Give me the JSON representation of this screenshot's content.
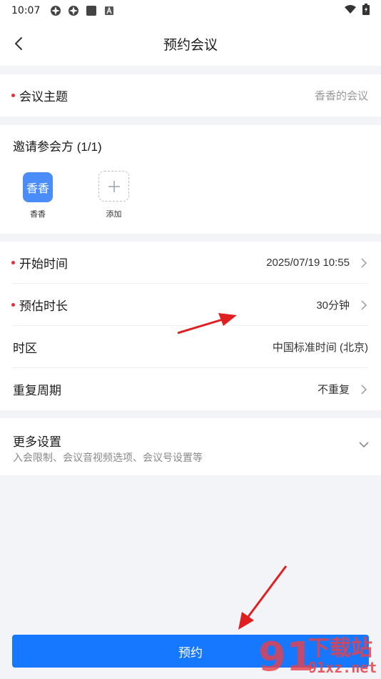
{
  "status_bar": {
    "time": "10:07"
  },
  "nav": {
    "title": "预约会议"
  },
  "topic": {
    "label": "会议主题",
    "placeholder": "香香的会议"
  },
  "invite": {
    "title": "邀请参会方 (1/1)",
    "participants": [
      {
        "avatar_text": "香香",
        "name": "香香"
      }
    ],
    "add_label": "添加"
  },
  "schedule": {
    "start_time": {
      "label": "开始时间",
      "value": "2025/07/19 10:55"
    },
    "duration": {
      "label": "预估时长",
      "value": "30分钟"
    },
    "timezone": {
      "label": "时区",
      "value": "中国标准时间 (北京)"
    },
    "repeat": {
      "label": "重复周期",
      "value": "不重复"
    }
  },
  "more_settings": {
    "title": "更多设置",
    "subtitle": "入会限制、会议音视频选项、会议号设置等"
  },
  "book_button": {
    "label": "预约"
  },
  "watermark": {
    "brand": "下载站",
    "domain": "91xz.net",
    "logo_text": "91"
  },
  "colors": {
    "primary": "#1677ff",
    "required_dot": "#e5303a",
    "avatar_bg": "#4b8df8",
    "annotation_arrow": "#e02020"
  }
}
